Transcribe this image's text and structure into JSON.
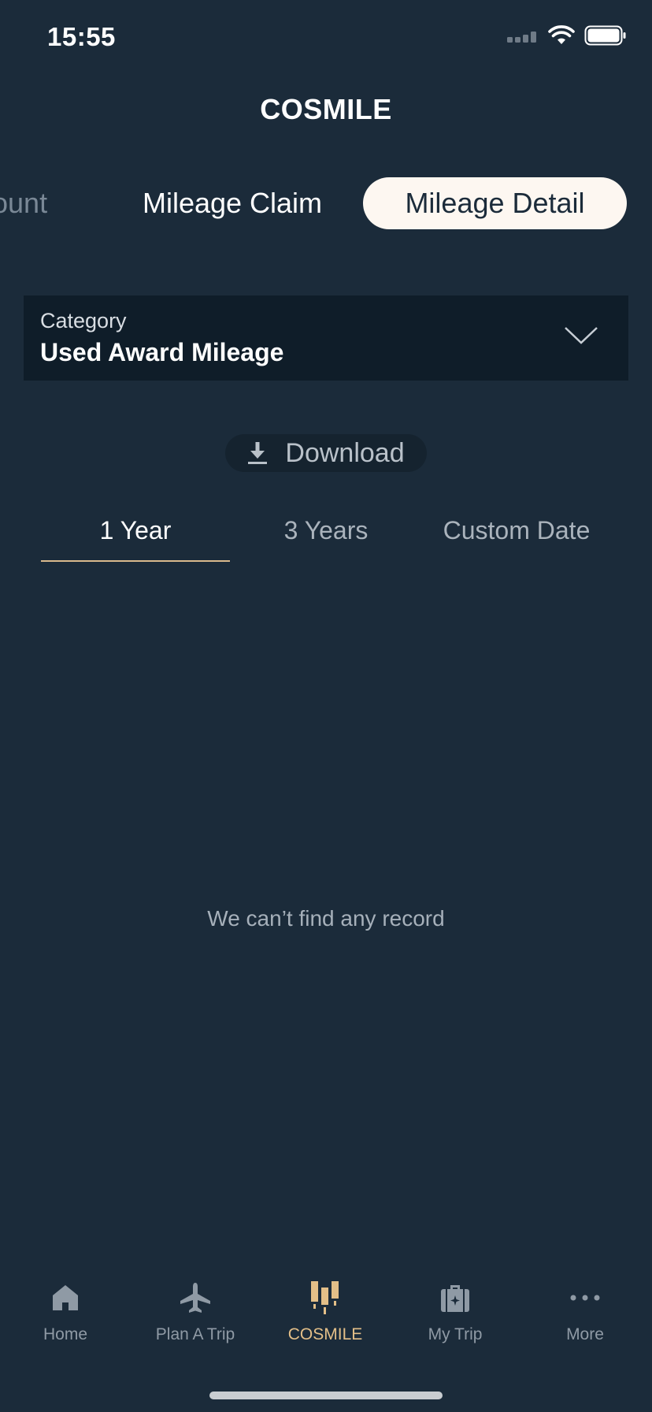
{
  "status_bar": {
    "time": "15:55",
    "icons": [
      "cellular-signal-icon",
      "wifi-icon",
      "battery-icon"
    ]
  },
  "header": {
    "title": "COSMILE"
  },
  "segment_tabs": {
    "partial_label": "ount",
    "claim_label": "Mileage Claim",
    "detail_label": "Mileage Detail",
    "selected": "Mileage Detail"
  },
  "category": {
    "label": "Category",
    "value": "Used Award Mileage",
    "icon": "chevron-down-icon"
  },
  "download": {
    "label": "Download",
    "icon": "download-icon"
  },
  "period_tabs": {
    "items": [
      "1 Year",
      "3 Years",
      "Custom Date"
    ],
    "selected": "1 Year"
  },
  "empty_state": {
    "message": "We can’t find any record"
  },
  "bottom_nav": {
    "items": [
      {
        "label": "Home",
        "icon": "home-icon"
      },
      {
        "label": "Plan A Trip",
        "icon": "airplane-icon"
      },
      {
        "label": "COSMILE",
        "icon": "cosmile-icon"
      },
      {
        "label": "My Trip",
        "icon": "suitcase-icon"
      },
      {
        "label": "More",
        "icon": "more-dots-icon"
      }
    ],
    "active": "COSMILE"
  },
  "colors": {
    "background": "#1b2b3a",
    "panel": "#0f1d29",
    "accent": "#e3bf88",
    "selected_tab_bg": "#fdf7f1"
  }
}
